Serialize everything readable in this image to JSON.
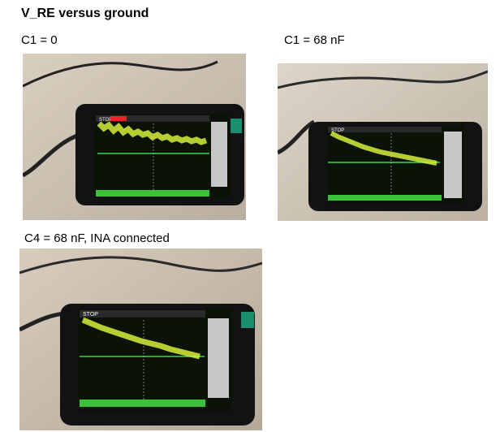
{
  "page": {
    "title": "V_RE versus ground"
  },
  "photos": [
    {
      "caption": "C1 = 0",
      "screen_status": "STOP",
      "trace": "noisy-flat"
    },
    {
      "caption": "C1 = 68 nF",
      "screen_status": "STOP",
      "trace": "decaying"
    },
    {
      "caption": "C4 = 68 nF, INA connected",
      "screen_status": "STOP",
      "trace": "decaying"
    }
  ],
  "colors": {
    "trace": "#d6f03a",
    "baseline": "#38d84a",
    "status": "#e02a2a",
    "panel_bg": "#0b1208"
  }
}
